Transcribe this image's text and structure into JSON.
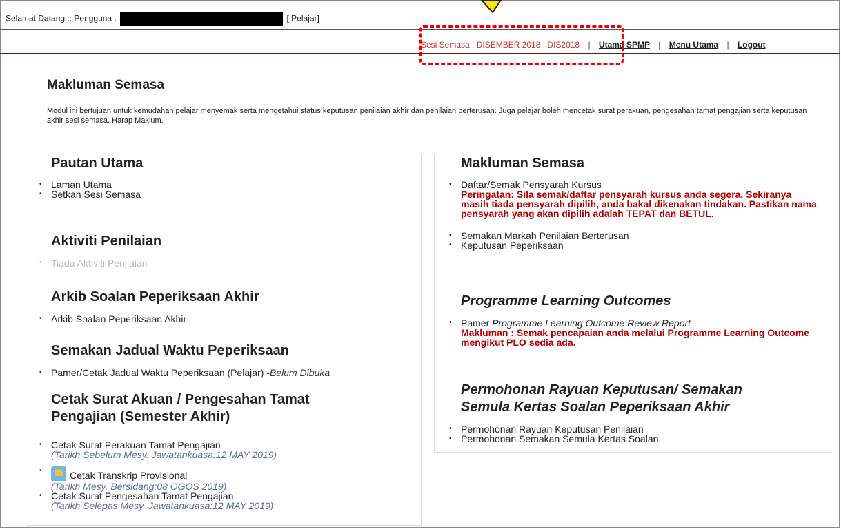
{
  "header": {
    "welcome_prefix": "Selamat Datang :: Pengguna :",
    "role": "[ Pelajar]",
    "sesi": "Sesi Semasa : DISEMBER 2018 : DIS2018",
    "links": [
      "Utama SPMP",
      "Menu Utama",
      "Logout"
    ]
  },
  "intro": {
    "title": "Makluman Semasa",
    "text": "Modul ini bertujuan untuk kemudahan pelajar menyemak serta mengetahui status keputusan penilaian akhir dan penilaian berterusan. Juga pelajar boleh mencetak surat perakuan, pengesahan tamat pengajian serta keputusan akhir sesi semasa. Harap Maklum."
  },
  "left": {
    "pautan_title": "Pautan Utama",
    "pautan_items": [
      "Laman Utama",
      "Setkan Sesi Semasa"
    ],
    "aktiviti_title": "Aktiviti Penilaian",
    "aktiviti_item": "Tiada Aktiviti Penilaian",
    "arkib_title": "Arkib Soalan Peperiksaan Akhir",
    "arkib_item": "Arkib Soalan Peperiksaan Akhir",
    "jadual_title": "Semakan Jadual Waktu Peperiksaan",
    "jadual_item": "Pamer/Cetak Jadual Waktu Peperiksaan (Pelajar) -",
    "jadual_note": "Belum Dibuka",
    "cetak_title_1": "Cetak Surat Akuan / Pengesahan Tamat",
    "cetak_title_2": "Pengajian (Semester Akhir)",
    "cetak_items": [
      {
        "label": "Cetak Surat Perakuan Tamat Pengajian",
        "note": "(Tarikh Sebelum Mesy. Jawatankuasa:12 MAY 2019)"
      },
      {
        "label": "Cetak Transkrip Provisional",
        "note": "(Tarikh Mesy. Bersidang:08 OGOS 2019)"
      },
      {
        "label": "Cetak Surat Pengesahan Tamat Pengajian",
        "note": "(Tarikh Selepas Mesy. Jawatankuasa:12 MAY 2019)"
      }
    ]
  },
  "right": {
    "makluman_title": "Makluman Semasa",
    "daftar_item": "Daftar/Semak Pensyarah Kursus",
    "peringatan": "Peringatan: Sila semak/daftar pensyarah kursus anda segera. Sekiranya masih tiada pensyarah dipilih, anda bakal dikenakan tindakan. Pastikan nama pensyarah yang akan dipilih adalah TEPAT dan BETUL.",
    "semakan_item": "Semakan Markah Penilaian Berterusan",
    "keputusan_item": "Keputusan Peperiksaan",
    "plo_title": "Programme Learning Outcomes",
    "plo_item_prefix": "Pamer ",
    "plo_item_italic": "Programme Learning Outcome Review Report",
    "plo_makluman": "Makluman : Semak pencapaian anda melalui Programme Learning Outcome mengikut PLO sedia ada.",
    "rayuan_title_1": "Permohonan Rayuan Keputusan/ Semakan",
    "rayuan_title_2": "Semula Kertas Soalan Peperiksaan Akhir",
    "rayuan_items": [
      "Permohonan Rayuan Keputusan Penilaian",
      "Permohonan Semakan Semula Kertas Soalan."
    ]
  },
  "colors": {
    "accent_red": "#b30000",
    "dashed_box": "#e00000",
    "note_blue": "#5a6a9a"
  }
}
